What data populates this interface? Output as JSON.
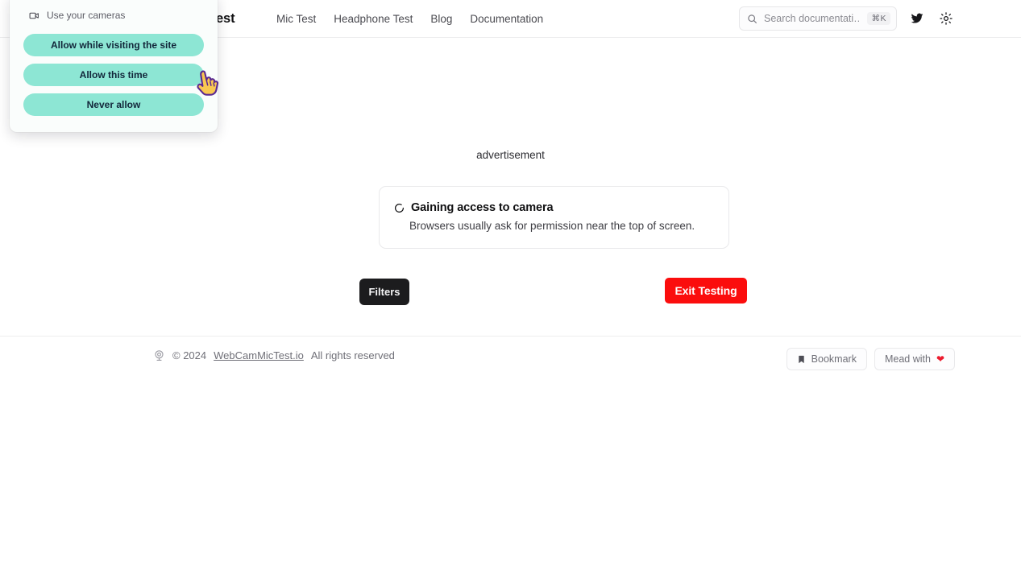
{
  "navbar": {
    "logo": "MicTest",
    "links": [
      {
        "label": "Mic Test"
      },
      {
        "label": "Headphone Test"
      },
      {
        "label": "Blog"
      },
      {
        "label": "Documentation"
      }
    ],
    "search": {
      "placeholder": "Search documentati…",
      "value": "",
      "shortcut": "⌘K",
      "icon": "search-icon"
    },
    "twitter_icon": "twitter-icon",
    "theme_icon": "sun-icon"
  },
  "main": {
    "ad_label": "advertisement",
    "status_card": {
      "spinner_icon": "loading-spinner-icon",
      "title": "Gaining access to camera",
      "subtitle": "Browsers usually ask for permission near the top of screen."
    },
    "filters_button": "Filters",
    "exit_button": "Exit Testing"
  },
  "footer": {
    "logo_icon": "webcam-icon",
    "copyright": "© 2024",
    "site_link": "WebCamMicTest.io",
    "rights": "All rights reserved",
    "bookmark_button": {
      "label": "Bookmark",
      "icon": "bookmark-icon"
    },
    "made_with_button": {
      "label": "Mead with",
      "icon": "heart-icon",
      "glyph": "❤"
    }
  },
  "permission_popup": {
    "camera_icon": "video-camera-icon",
    "header": "Use your cameras",
    "buttons": [
      {
        "label": "Allow while visiting the site"
      },
      {
        "label": "Allow this time"
      },
      {
        "label": "Never allow"
      }
    ]
  },
  "cursor": {
    "icon": "pointing-hand-cursor"
  },
  "colors": {
    "accent_mint": "#8de6d4",
    "danger_red": "#fb0d0d",
    "dark_button": "#1c1c1e",
    "heart_red": "#ec1b2e",
    "border_gray": "#e9e9eb",
    "text_muted": "#6f6f77"
  }
}
